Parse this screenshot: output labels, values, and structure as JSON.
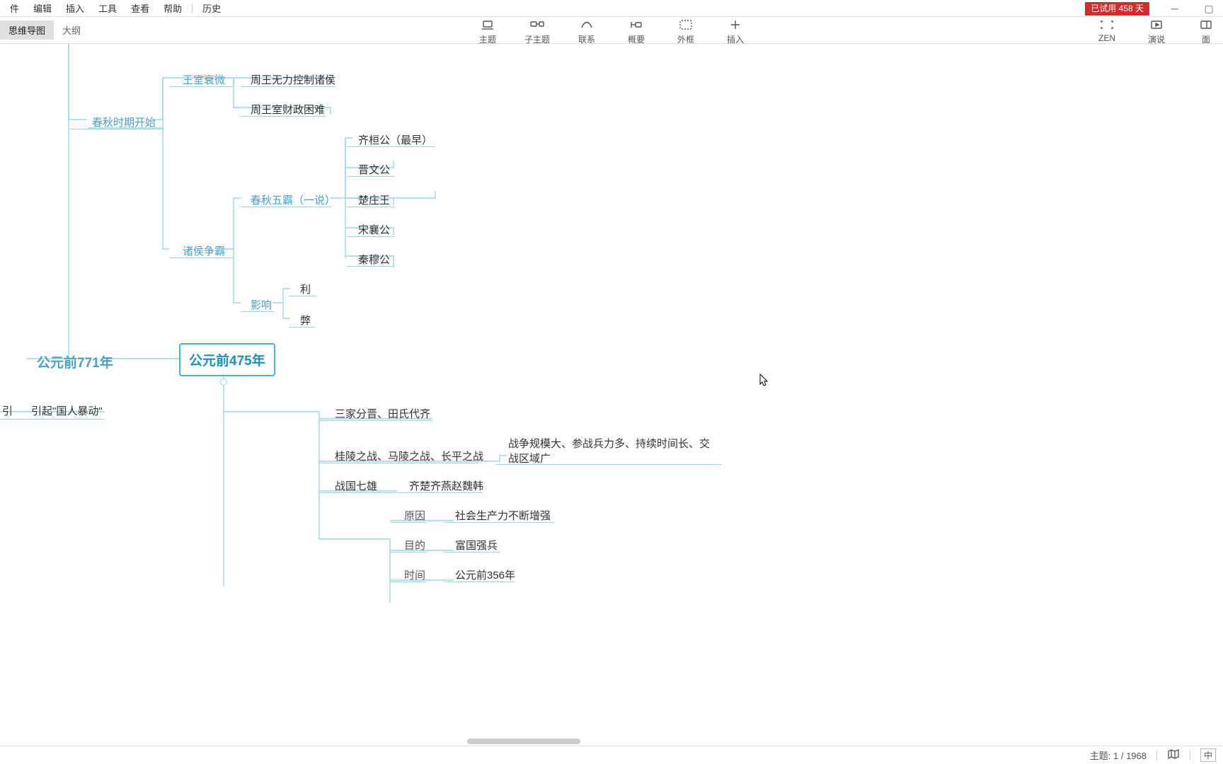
{
  "menu": {
    "items": [
      "件",
      "编辑",
      "插入",
      "工具",
      "查看",
      "帮助"
    ],
    "history": "历史"
  },
  "trial": {
    "label": "已试用 458 天"
  },
  "view_tabs": {
    "mindmap": "思维导图",
    "outline": "大纲"
  },
  "toolbar": {
    "center": [
      {
        "name": "topic",
        "label": "主题"
      },
      {
        "name": "subtopic",
        "label": "子主题"
      },
      {
        "name": "relation",
        "label": "联系"
      },
      {
        "name": "summary",
        "label": "概要"
      },
      {
        "name": "boundary",
        "label": "外框"
      },
      {
        "name": "insert",
        "label": "插入"
      }
    ],
    "right": [
      {
        "name": "zen",
        "label": "ZEN"
      },
      {
        "name": "present",
        "label": "演说"
      },
      {
        "name": "panel",
        "label": "面"
      }
    ]
  },
  "nodes": {
    "n771": "公元前771年",
    "n475": "公元前475年",
    "riot": "引起\"国人暴动\"",
    "spring_start": "春秋时期开始",
    "royal_decline": "王室衰微",
    "zhou_nocontrol": "周王无力控制诸侯",
    "zhou_finance": "周王室财政困难",
    "lords_war": "诸侯争霸",
    "five_hegemon": "春秋五霸（一说）",
    "qi_huan": "齐桓公（最早）",
    "jin_wen": "晋文公",
    "chu_zhuang": "楚庄王",
    "song_xiang": "宋襄公",
    "qin_mu": "秦穆公",
    "impact": "影响",
    "pro": "利",
    "con": "弊",
    "sanjia": "三家分晋、田氏代齐",
    "battles": "桂陵之战、马陵之战、长平之战",
    "war_scale": "战争规模大、参战兵力多、持续时间长、交战区域广",
    "seven_states": "战国七雄",
    "seven_list": "齐楚齐燕赵魏韩",
    "reason": "原因",
    "reason_v": "社会生产力不断增强",
    "purpose": "目的",
    "purpose_v": "富国强兵",
    "time": "时间",
    "time_v": "公元前356年"
  },
  "status": {
    "topic_label": "主题:",
    "topic_current": "1",
    "topic_total": "1968",
    "ime": "中"
  }
}
